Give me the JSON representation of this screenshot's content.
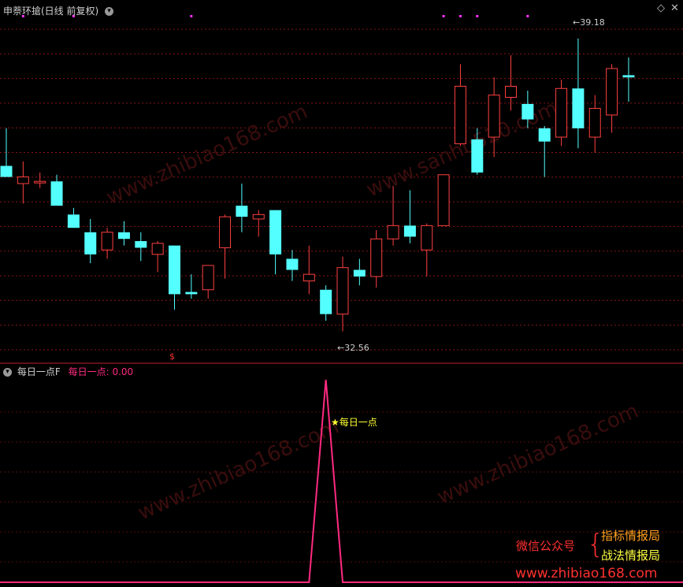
{
  "top_panel": {
    "title": "申萘环搶(日线 前复权)",
    "max_label": "39.18",
    "min_label": "32.56",
    "signal_mark": "$",
    "arrow_glyph": "←",
    "collapse_icon": "chevron-down-icon",
    "window_icon": "diamond-icon"
  },
  "bottom_panel": {
    "name": "每日一点F",
    "series_name": "每日一点",
    "value": "0.00",
    "star_label": "每日一点"
  },
  "watermark": {
    "line1": "微信公众号",
    "brace": "{",
    "line2a": "指标情报局",
    "line2b": "战法情报局",
    "url": "www.zhibiao168.com"
  },
  "colors": {
    "up": "#ff4040",
    "down": "#54ffff",
    "grid": "#8a1414",
    "indicator": "#ff2a80",
    "magenta_dot": "#ff30ff",
    "label": "#cccccc",
    "star": "#ffff30"
  },
  "chart_data": {
    "type": "candlestick",
    "title": "申萘环搶(日线 前复权)",
    "ylim": [
      32.0,
      39.8
    ],
    "candles": [
      {
        "o": 36.3,
        "h": 37.15,
        "l": 36.05,
        "c": 36.05
      },
      {
        "o": 35.9,
        "h": 36.4,
        "l": 35.45,
        "c": 36.05
      },
      {
        "o": 35.95,
        "h": 36.15,
        "l": 35.8,
        "c": 35.95
      },
      {
        "o": 35.95,
        "h": 36.1,
        "l": 35.45,
        "c": 35.4
      },
      {
        "o": 35.2,
        "h": 35.35,
        "l": 34.9,
        "c": 34.9
      },
      {
        "o": 34.8,
        "h": 35.1,
        "l": 34.1,
        "c": 34.3
      },
      {
        "o": 34.4,
        "h": 34.9,
        "l": 34.2,
        "c": 34.8
      },
      {
        "o": 34.8,
        "h": 35.05,
        "l": 34.5,
        "c": 34.65
      },
      {
        "o": 34.6,
        "h": 34.8,
        "l": 34.15,
        "c": 34.45
      },
      {
        "o": 34.3,
        "h": 34.6,
        "l": 33.9,
        "c": 34.55
      },
      {
        "o": 34.5,
        "h": 34.5,
        "l": 33.05,
        "c": 33.4
      },
      {
        "o": 33.45,
        "h": 33.85,
        "l": 33.3,
        "c": 33.4
      },
      {
        "o": 33.5,
        "h": 34.05,
        "l": 33.3,
        "c": 34.05
      },
      {
        "o": 34.45,
        "h": 35.2,
        "l": 33.75,
        "c": 35.15
      },
      {
        "o": 35.4,
        "h": 35.9,
        "l": 34.8,
        "c": 35.15
      },
      {
        "o": 35.1,
        "h": 35.3,
        "l": 34.7,
        "c": 35.2
      },
      {
        "o": 35.3,
        "h": 35.3,
        "l": 33.85,
        "c": 34.3
      },
      {
        "o": 34.2,
        "h": 34.4,
        "l": 33.7,
        "c": 33.95
      },
      {
        "o": 33.7,
        "h": 34.5,
        "l": 33.4,
        "c": 33.85
      },
      {
        "o": 33.5,
        "h": 33.6,
        "l": 32.8,
        "c": 32.95
      },
      {
        "o": 32.95,
        "h": 34.25,
        "l": 32.56,
        "c": 34.0
      },
      {
        "o": 33.95,
        "h": 34.2,
        "l": 33.6,
        "c": 33.8
      },
      {
        "o": 33.8,
        "h": 34.85,
        "l": 33.55,
        "c": 34.65
      },
      {
        "o": 34.65,
        "h": 35.85,
        "l": 34.5,
        "c": 34.95
      },
      {
        "o": 34.95,
        "h": 35.75,
        "l": 34.55,
        "c": 34.7
      },
      {
        "o": 34.4,
        "h": 35.0,
        "l": 33.8,
        "c": 34.95
      },
      {
        "o": 34.95,
        "h": 36.1,
        "l": 34.95,
        "c": 36.1
      },
      {
        "o": 36.8,
        "h": 38.6,
        "l": 36.75,
        "c": 38.1
      },
      {
        "o": 36.9,
        "h": 37.15,
        "l": 36.1,
        "c": 36.15
      },
      {
        "o": 36.95,
        "h": 38.3,
        "l": 36.5,
        "c": 37.9
      },
      {
        "o": 37.85,
        "h": 38.8,
        "l": 37.55,
        "c": 38.1
      },
      {
        "o": 37.7,
        "h": 38.0,
        "l": 37.15,
        "c": 37.35
      },
      {
        "o": 37.15,
        "h": 37.2,
        "l": 36.05,
        "c": 36.85
      },
      {
        "o": 36.95,
        "h": 38.25,
        "l": 36.75,
        "c": 38.05
      },
      {
        "o": 38.05,
        "h": 39.18,
        "l": 36.7,
        "c": 37.15
      },
      {
        "o": 36.95,
        "h": 37.9,
        "l": 36.6,
        "c": 37.6
      },
      {
        "o": 37.45,
        "h": 38.6,
        "l": 37.05,
        "c": 38.5
      },
      {
        "o": 38.35,
        "h": 38.75,
        "l": 37.75,
        "c": 38.3
      }
    ],
    "signals": {
      "top_dots_index": [
        1,
        4,
        11,
        26,
        27,
        28,
        31
      ],
      "bottom_mark_index": 10
    },
    "indicator": {
      "name": "每日一点",
      "ylim": [
        0,
        1
      ],
      "values": [
        0,
        0,
        0,
        0,
        0,
        0,
        0,
        0,
        0,
        0,
        0,
        0,
        0,
        0,
        0,
        0,
        0,
        0,
        0,
        1,
        0,
        0,
        0,
        0,
        0,
        0,
        0,
        0,
        0,
        0,
        0,
        0,
        0,
        0,
        0,
        0,
        0,
        0
      ]
    }
  }
}
